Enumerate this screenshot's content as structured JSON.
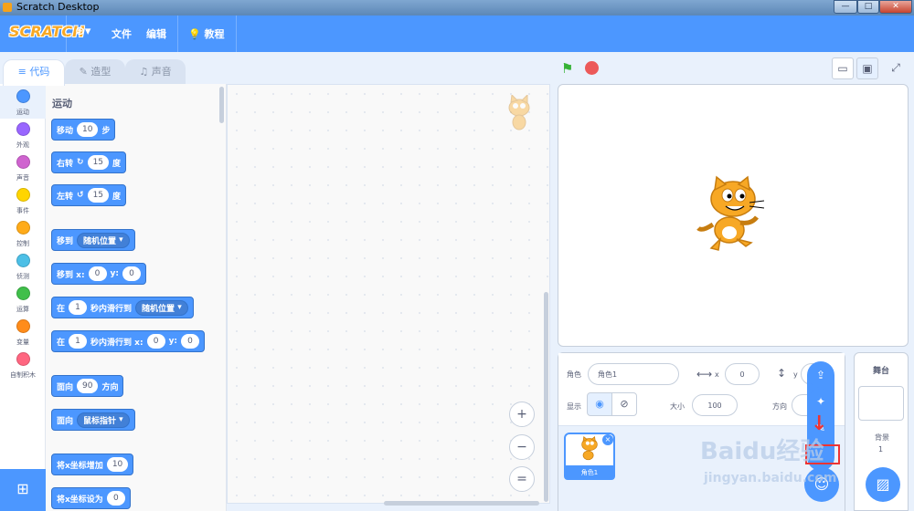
{
  "window": {
    "title": "Scratch Desktop",
    "min": "—",
    "max": "□",
    "close": "✕"
  },
  "menubar": {
    "logo": "SCRATCH",
    "lang": "⊕▾",
    "file": "文件",
    "edit": "编辑",
    "tutorials": "教程"
  },
  "tabs": [
    {
      "label": "代码",
      "icon": "code-icon",
      "active": true
    },
    {
      "label": "造型",
      "icon": "brush-icon",
      "active": false
    },
    {
      "label": "声音",
      "icon": "speaker-icon",
      "active": false
    }
  ],
  "categories": [
    {
      "label": "运动",
      "color": "#4c97ff"
    },
    {
      "label": "外观",
      "color": "#9966ff"
    },
    {
      "label": "声音",
      "color": "#cf63cf"
    },
    {
      "label": "事件",
      "color": "#ffd500"
    },
    {
      "label": "控制",
      "color": "#ffab19"
    },
    {
      "label": "侦测",
      "color": "#4cbfe6"
    },
    {
      "label": "运算",
      "color": "#40bf4a"
    },
    {
      "label": "变量",
      "color": "#ff8c1a"
    },
    {
      "label": "自制积木",
      "color": "#ff6680"
    }
  ],
  "palette": {
    "section": "运动",
    "b1": {
      "pre": "移动",
      "val": "10",
      "post": "步"
    },
    "b2": {
      "pre": "右转",
      "val": "15",
      "post": "度"
    },
    "b3": {
      "pre": "左转",
      "val": "15",
      "post": "度"
    },
    "b4": {
      "pre": "移到",
      "drop": "随机位置"
    },
    "b5": {
      "pre": "移到 x:",
      "x": "0",
      "y_label": "y:",
      "y": "0"
    },
    "b6": {
      "pre": "在",
      "val": "1",
      "mid": "秒内滑行到",
      "drop": "随机位置"
    },
    "b7": {
      "pre": "在",
      "val": "1",
      "mid": "秒内滑行到 x:",
      "x": "0",
      "y_label": "y:",
      "y": "0"
    },
    "b8": {
      "pre": "面向",
      "val": "90",
      "post": "方向"
    },
    "b9": {
      "pre": "面向",
      "drop": "鼠标指针"
    },
    "b10": {
      "pre": "将x坐标增加",
      "val": "10"
    },
    "b11": {
      "pre": "将x坐标设为",
      "val": "0"
    }
  },
  "zoom": {
    "in": "+",
    "out": "−",
    "reset": "="
  },
  "sprite": {
    "name_label": "角色",
    "name": "角色1",
    "x_label": "x",
    "x": "0",
    "y_label": "y",
    "show_label": "显示",
    "size_label": "大小",
    "size": "100",
    "dir_label": "方向",
    "thumb_label": "角色1"
  },
  "stage_panel": {
    "title": "舞台",
    "backdrop_label": "背景",
    "backdrop_count": "1"
  },
  "watermark": {
    "logo": "Baidu经验",
    "url": "jingyan.baidu.com"
  }
}
